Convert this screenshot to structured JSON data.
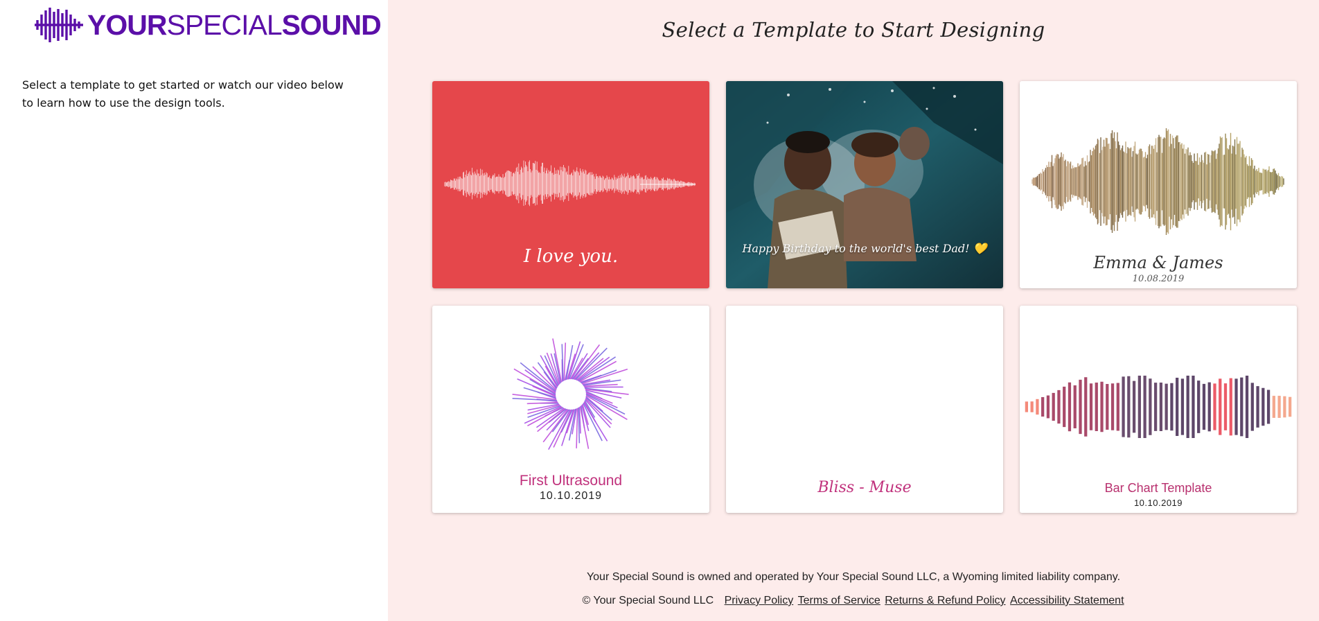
{
  "brand": {
    "logo_text_part1": "YOUR",
    "logo_text_part2": "SPECIAL",
    "logo_text_part3": "SOUND",
    "logo_icon": "soundwave-bars-icon",
    "color": "#5b0fa8"
  },
  "sidebar": {
    "intro": "Select a template to get started or watch our video below to learn how to use the design tools."
  },
  "main": {
    "title": "Select a Template to Start Designing",
    "background": "#fdeceb"
  },
  "templates": [
    {
      "caption": "I love you.",
      "background": "#e5474b"
    },
    {
      "caption": "Happy Birthday to the world's best Dad! 💛"
    },
    {
      "caption": "Emma & James",
      "subcaption": "10.08.2019"
    },
    {
      "caption": "First Ultrasound",
      "subcaption": "10.10.2019"
    },
    {
      "caption": "Bliss - Muse"
    },
    {
      "caption": "Bar Chart Template",
      "subcaption": "10.10.2019"
    }
  ],
  "footer": {
    "ownership": "Your Special Sound is owned and operated by Your Special Sound LLC, a Wyoming limited liability company.",
    "copyright": "© Your Special Sound LLC",
    "links": [
      "Privacy Policy",
      "Terms of Service",
      "Returns & Refund Policy",
      "Accessibility Statement"
    ]
  }
}
